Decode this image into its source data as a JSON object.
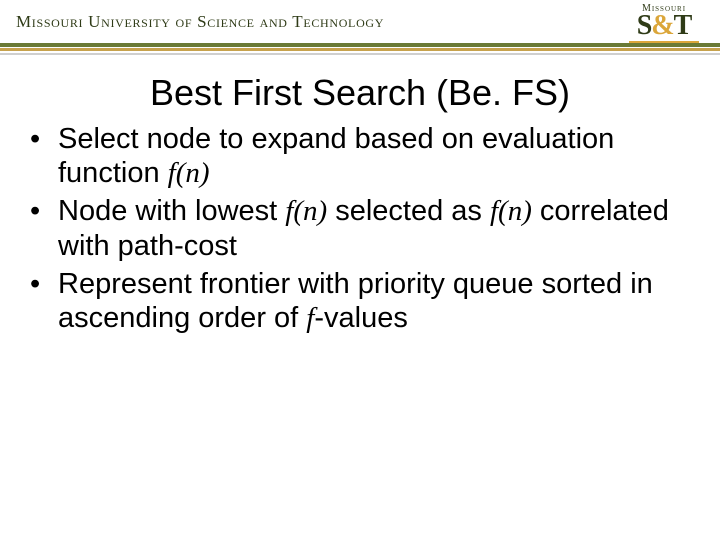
{
  "header": {
    "university": "Missouri University of Science and Technology",
    "logo_top": "Missouri",
    "logo_main_html": "S<span class=\"amp\">&amp;</span>T"
  },
  "title": "Best First Search (Be. FS)",
  "bullets": [
    "Select node to expand based on evaluation function <span class=\"fstyle\">f(n)</span>",
    "Node with lowest <span class=\"fstyle\">f(n)</span> selected as <span class=\"fstyle\">f(n)</span> correlated with path-cost",
    "Represent frontier with priority queue sorted in ascending order of <span class=\"fstyle\">f</span>-values"
  ]
}
